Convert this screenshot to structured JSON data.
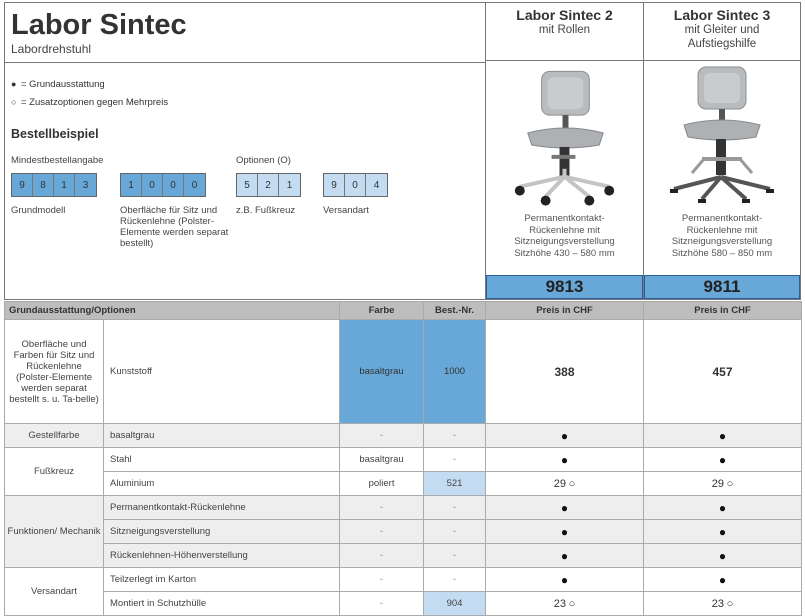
{
  "header": {
    "title": "Labor Sintec",
    "subtitle": "Labordrehstuhl",
    "legend_standard": "= Grundausstattung",
    "legend_optional": "= Zusatzoptionen gegen Mehrpreis",
    "bestell_title": "Bestellbeispiel",
    "min_label": "Mindestbestellangabe",
    "options_label": "Optionen (O)"
  },
  "order_example": {
    "groups": [
      {
        "digits": [
          "9",
          "8",
          "1",
          "3"
        ],
        "label": "Grundmodell"
      },
      {
        "digits": [
          "1",
          "0",
          "0",
          "0"
        ],
        "label": "Oberfläche für Sitz und Rückenlehne (Polster-Elemente werden separat bestellt)"
      },
      {
        "digits": [
          "5",
          "2",
          "1"
        ],
        "label": "z.B. Fußkreuz"
      },
      {
        "digits": [
          "9",
          "0",
          "4"
        ],
        "label": "Versandart"
      }
    ]
  },
  "products": [
    {
      "name": "Labor Sintec 2",
      "sub": "mit Rollen",
      "desc1": "Permanentkontakt-",
      "desc2": "Rückenlehne  mit",
      "desc3": "Sitzneigungsverstellung",
      "desc4": "Sitzhöhe 430 – 580 mm",
      "number": "9813"
    },
    {
      "name": "Labor Sintec 3",
      "sub": "mit Gleiter und Aufstiegshilfe",
      "desc1": "Permanentkontakt-",
      "desc2": "Rückenlehne  mit",
      "desc3": "Sitzneigungsverstellung",
      "desc4": "Sitzhöhe 580 – 850 mm",
      "number": "9811"
    }
  ],
  "table": {
    "headers": {
      "options": "Grundausstattung/Optionen",
      "color": "Farbe",
      "order_no": "Best.-Nr.",
      "price1": "Preis in CHF",
      "price2": "Preis in CHF"
    },
    "surface": {
      "group": "Oberfläche und Farben für Sitz und Rückenlehne (Polster-Elemente werden separat bestellt s. u. Ta-belle)",
      "name": "Kunststoff",
      "color": "basaltgrau",
      "no": "1000",
      "p1": "388",
      "p2": "457"
    },
    "frame": {
      "group": "Gestellfarbe",
      "name": "basaltgrau",
      "color": "-",
      "no": "-"
    },
    "base_group": "Fußkreuz",
    "base_steel": {
      "name": "Stahl",
      "color": "basaltgrau",
      "no": "-"
    },
    "base_alu": {
      "name": "Aluminium",
      "color": "poliert",
      "no": "521",
      "p1": "29",
      "p2": "29"
    },
    "func_group": "Funktionen/ Mechanik",
    "func1": {
      "name": "Permanentkontakt-Rückenlehne",
      "color": "-",
      "no": "-"
    },
    "func2": {
      "name": "Sitzneigungsverstellung",
      "color": "-",
      "no": "-"
    },
    "func3": {
      "name": "Rückenlehnen-Höhenverstellung",
      "color": "-",
      "no": "-"
    },
    "ship_group": "Versandart",
    "ship1": {
      "name": "Teilzerlegt im Karton",
      "color": "-",
      "no": "-"
    },
    "ship2": {
      "name": "Montiert in Schutzhülle",
      "color": "-",
      "no": "904",
      "p1": "23",
      "p2": "23"
    }
  },
  "symbols": {
    "standard": "●",
    "optional": "○"
  },
  "colors": {
    "accent": "#68a8d8",
    "light_accent": "#c4dcf1",
    "header_gray": "#bdbdbd",
    "row_gray": "#eeeeee"
  }
}
